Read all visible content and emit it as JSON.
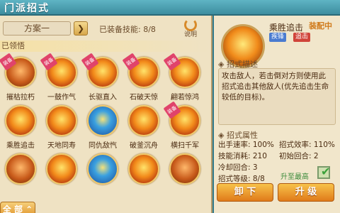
{
  "title": "门派招式",
  "scheme": {
    "name": "方案一",
    "arrow": "❯"
  },
  "equip_count": {
    "label": "已装备技能:",
    "value": "8/8"
  },
  "rotate_label": "说明",
  "section_label": "已领悟",
  "skills": [
    {
      "name": "摧枯拉朽",
      "tag": "装备",
      "style": "dim"
    },
    {
      "name": "一鼓作气",
      "tag": "装备",
      "style": ""
    },
    {
      "name": "长驱直入",
      "tag": "装备",
      "style": ""
    },
    {
      "name": "石破天惊",
      "tag": "装备",
      "style": ""
    },
    {
      "name": "翩若惊鸿",
      "tag": "装备",
      "style": ""
    },
    {
      "name": "乘胜追击",
      "tag": "",
      "style": ""
    },
    {
      "name": "天地同寿",
      "tag": "",
      "style": ""
    },
    {
      "name": "同仇敌忾",
      "tag": "",
      "style": "blue"
    },
    {
      "name": "破釜沉舟",
      "tag": "",
      "style": ""
    },
    {
      "name": "横扫千军",
      "tag": "装备",
      "style": ""
    },
    {
      "name": "",
      "tag": "",
      "style": "dim"
    },
    {
      "name": "",
      "tag": "",
      "style": ""
    },
    {
      "name": "",
      "tag": "",
      "style": "blue"
    },
    {
      "name": "",
      "tag": "",
      "style": ""
    },
    {
      "name": "",
      "tag": "",
      "style": "dim"
    }
  ],
  "all_button": "全 部 ⌃",
  "detail": {
    "name": "乘胜追击",
    "equipped": "装配中",
    "badge1": "疾锋",
    "badge2": "追击",
    "desc_head": "◈ 招式描述",
    "desc": "攻击敌人，若击倒对方则使用此招式追击其他敌人(优先追击生命较低的目标)。",
    "attr_head": "◈ 招式属性",
    "speed": "出手速率: 100%",
    "efficiency": "招式效率: 110%",
    "cost": "技能消耗: 210",
    "init_round": "初始回合: 2",
    "cooldown": "冷却回合: 3",
    "level": "招式等级: 8/8",
    "upgrade_max": "升至最高",
    "unload_button": "卸 下",
    "upgrade_button": "升 级"
  }
}
